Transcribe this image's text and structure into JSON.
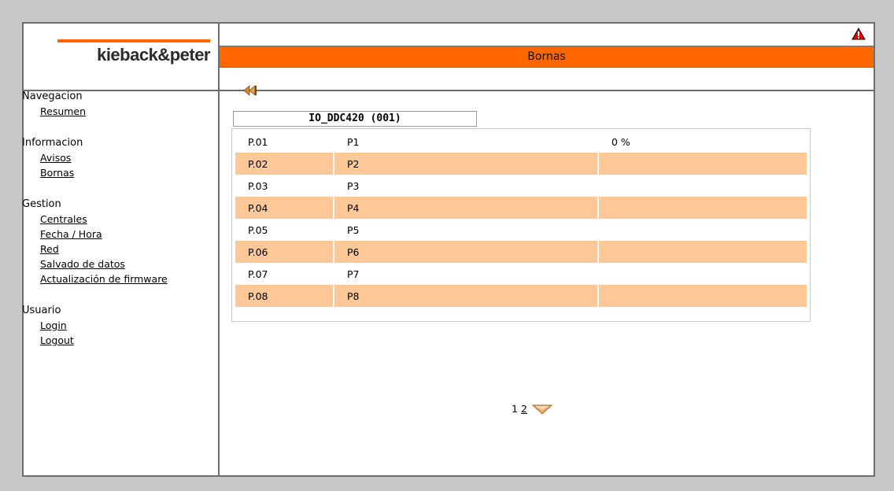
{
  "header": {
    "logo_text": "kieback&peter",
    "title": "Bornas",
    "warning_icon": "warning-triangle-icon"
  },
  "sidebar": {
    "groups": [
      {
        "title": "Navegacion",
        "items": [
          "Resumen"
        ]
      },
      {
        "title": "Informacion",
        "items": [
          "Avisos",
          "Bornas"
        ]
      },
      {
        "title": "Gestion",
        "items": [
          "Centrales",
          "Fecha / Hora",
          "Red",
          "Salvado de datos",
          "Actualización de firmware"
        ]
      },
      {
        "title": "Usuario",
        "items": [
          "Login",
          "Logout"
        ]
      }
    ]
  },
  "main": {
    "back_icon": "rewind-back-icon",
    "device_title": "IO_DDC420 (001)",
    "rows": [
      {
        "id": "P.01",
        "name": "P1",
        "value": "0 %"
      },
      {
        "id": "P.02",
        "name": "P2",
        "value": ""
      },
      {
        "id": "P.03",
        "name": "P3",
        "value": ""
      },
      {
        "id": "P.04",
        "name": "P4",
        "value": ""
      },
      {
        "id": "P.05",
        "name": "P5",
        "value": ""
      },
      {
        "id": "P.06",
        "name": "P6",
        "value": ""
      },
      {
        "id": "P.07",
        "name": "P7",
        "value": ""
      },
      {
        "id": "P.08",
        "name": "P8",
        "value": ""
      }
    ]
  },
  "pager": {
    "current": "1",
    "next_page": "2",
    "next_icon": "chevron-down-icon"
  },
  "colors": {
    "accent": "#ff6600",
    "row_alt": "#ffc896",
    "border": "#6e6e6e",
    "background": "#c8c8c8"
  }
}
